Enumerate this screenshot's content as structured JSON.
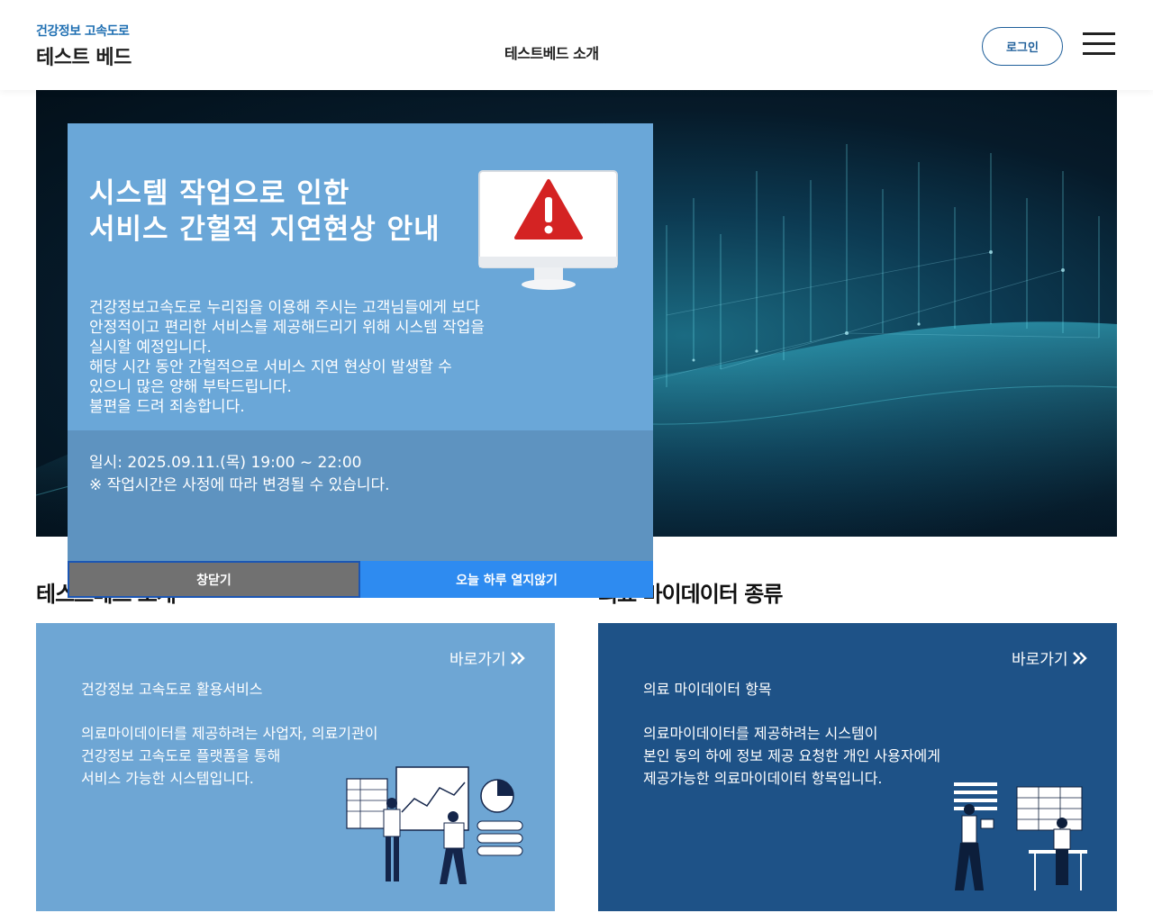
{
  "header": {
    "logo_top": "건강정보 고속도로",
    "logo_bottom": "테스트 베드",
    "nav_link": "테스트베드 소개",
    "login_label": "로그인",
    "menu_icon": "hamburger-menu-icon"
  },
  "sections": {
    "left_title": "테스트베드 소개",
    "right_title": "의료 마이데이터 종류"
  },
  "cards": [
    {
      "go_label": "바로가기",
      "title": "건강정보 고속도로 활용서비스",
      "desc": [
        "의료마이데이터를 제공하려는 사업자, 의료기관이",
        "건강정보 고속도로 플랫폼을 통해",
        "서비스 가능한 시스템입니다."
      ],
      "illustration": "data-analysis-illustration",
      "bg": "#6ea6d4"
    },
    {
      "go_label": "바로가기",
      "title": "의료 마이데이터 항목",
      "desc": [
        "의료마이데이터를 제공하려는 시스템이",
        "본인 동의 하에 정보 제공 요청한 개인 사용자에게",
        "제공가능한 의료마이데이터 항목입니다."
      ],
      "illustration": "presentation-illustration",
      "bg": "#1e5287"
    }
  ],
  "popup": {
    "title": [
      "시스템 작업으로 인한",
      "서비스 간헐적 지연현상 안내"
    ],
    "body": [
      "건강정보고속도로 누리집을 이용해 주시는 고객님들에게 보다",
      "안정적이고 편리한 서비스를 제공해드리기 위해 시스템 작업을",
      "실시할 예정입니다.",
      "해당 시간 동안 간헐적으로 서비스 지연 현상이 발생할 수",
      "있으니 많은 양해 부탁드립니다.",
      "불편을 드려 죄송합니다."
    ],
    "date_line": "일시: 2025.09.11.(목) 19:00 ~ 22:00",
    "note_line": "※ 작업시간은 사정에 따라 변경될 수 있습니다.",
    "close_label": "창닫기",
    "today_label": "오늘 하루 열지않기",
    "icon": "warning-monitor-icon"
  },
  "colors": {
    "brand": "#1f6fb2",
    "popup_top": "#6aa7d8",
    "popup_bottom": "#5e93c0",
    "close_btn": "#717171",
    "today_btn": "#2e8bf0"
  }
}
